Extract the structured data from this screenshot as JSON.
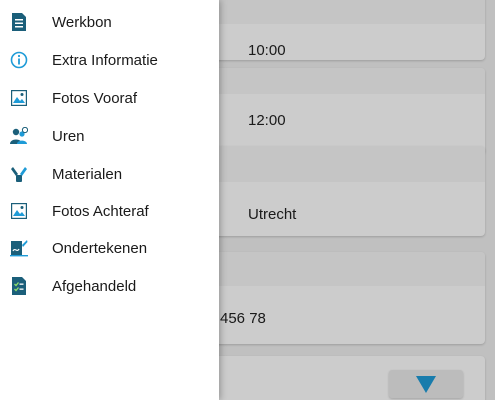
{
  "drawer": {
    "items": [
      {
        "label": "Werkbon",
        "icon": "document-icon"
      },
      {
        "label": "Extra Informatie",
        "icon": "info-icon"
      },
      {
        "label": "Fotos Vooraf",
        "icon": "image-icon"
      },
      {
        "label": "Uren",
        "icon": "users-clock-icon"
      },
      {
        "label": "Materialen",
        "icon": "tools-icon"
      },
      {
        "label": "Fotos Achteraf",
        "icon": "image-icon"
      },
      {
        "label": "Ondertekenen",
        "icon": "signature-icon"
      },
      {
        "label": "Afgehandeld",
        "icon": "checklist-icon"
      }
    ]
  },
  "content": {
    "start_time": "10:00",
    "end_time": "12:00",
    "city": "Utrecht",
    "phone_partial": "456 78"
  },
  "colors": {
    "accent": "#1e9bd7",
    "icon_dark": "#1b5f7a"
  }
}
